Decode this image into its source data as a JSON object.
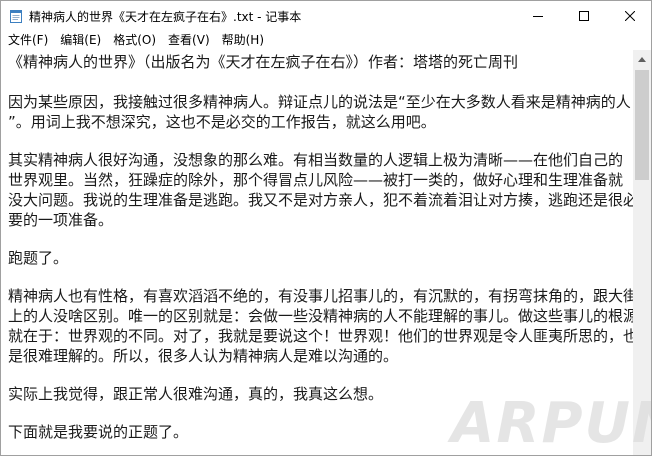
{
  "window": {
    "title": "精神病人的世界《天才在左疯子在右》.txt - 记事本",
    "app_icon": "notepad-icon",
    "controls": [
      "minimize-icon",
      "maximize-icon",
      "close-icon"
    ]
  },
  "menu": {
    "items": [
      {
        "label": "文件(F)"
      },
      {
        "label": "编辑(E)"
      },
      {
        "label": "格式(O)"
      },
      {
        "label": "查看(V)"
      },
      {
        "label": "帮助(H)"
      }
    ]
  },
  "document": {
    "lines": [
      "《精神病人的世界》（出版名为《天才在左疯子在右》）作者：塔塔的死亡周刊",
      "",
      "因为某些原因，我接触过很多精神病人。辩证点儿的说法是“至少在大多数人看来是精神病的人",
      "”。用词上我不想深究，这也不是必交的工作报告，就这么用吧。",
      "",
      "其实精神病人很好沟通，没想象的那么难。有相当数量的人逻辑上极为清晰——在他们自己的",
      "世界观里。当然，狂躁症的除外，那个得冒点儿风险——被打一类的，做好心理和生理准备就",
      "没大问题。我说的生理准备是逃跑。我又不是对方亲人，犯不着流着泪让对方揍，逃跑还是很必",
      "要的一项准备。",
      "",
      "跑题了。",
      "",
      "精神病人也有性格，有喜欢滔滔不绝的，有没事儿招事儿的，有沉默的，有拐弯抹角的，跟大街",
      "上的人没啥区别。唯一的区别就是：会做一些没精神病的人不能理解的事儿。做这些事儿的根源",
      "就在于：世界观的不同。对了，我就是要说这个！世界观！他们的世界观是令人匪夷所思的，也",
      "是很难理解的。所以，很多人认为精神病人是难以沟通的。",
      "",
      "实际上我觉得，跟正常人很难沟通，真的，我真这么想。",
      "",
      "下面就是我要说的正题了。"
    ]
  },
  "scrollbar": {
    "up_icon": "scroll-up-arrow-icon"
  },
  "watermark": {
    "text": "ARPUN"
  }
}
